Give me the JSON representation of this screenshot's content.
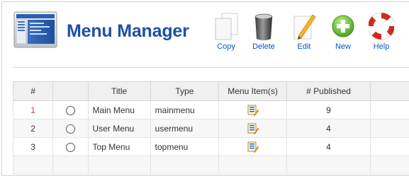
{
  "header": {
    "title": "Menu Manager",
    "title_color": "#1f50a5"
  },
  "toolbar": {
    "buttons": [
      {
        "label": "Copy",
        "icon": "copy-icon"
      },
      {
        "label": "Delete",
        "icon": "trash-can-icon"
      },
      {
        "label": "Edit",
        "icon": "pencil-edit-icon"
      },
      {
        "label": "New",
        "icon": "plus-new-icon"
      },
      {
        "label": "Help",
        "icon": "lifebuoy-help-icon"
      }
    ]
  },
  "table": {
    "columns": [
      "#",
      "",
      "Title",
      "Type",
      "Menu Item(s)",
      "# Published",
      ""
    ],
    "rows": [
      {
        "num": "1",
        "title": "Main Menu",
        "type": "mainmenu",
        "published": "9"
      },
      {
        "num": "2",
        "title": "User Menu",
        "type": "usermenu",
        "published": "4"
      },
      {
        "num": "3",
        "title": "Top Menu",
        "type": "topmenu",
        "published": "4"
      }
    ]
  },
  "colors": {
    "link": "#0b55c4",
    "header_bg": "#f0f0f0",
    "row_num_first": "#c64934"
  }
}
